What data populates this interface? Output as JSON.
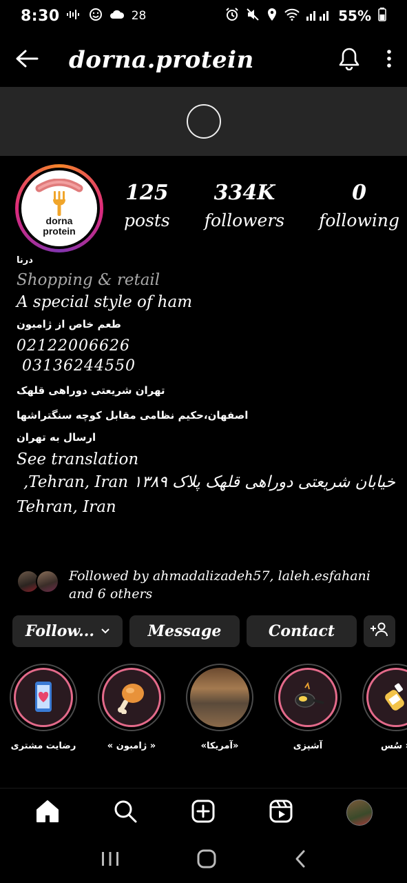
{
  "status_bar": {
    "time": "8:30",
    "left_text": "28",
    "battery": "55%"
  },
  "header": {
    "username": "dorna.protein"
  },
  "profile": {
    "logo_line1": "dorna",
    "logo_line2": "protein",
    "stats": {
      "posts_count": "125",
      "posts_label": "posts",
      "followers_count": "334K",
      "followers_label": "followers",
      "following_count": "0",
      "following_label": "following"
    }
  },
  "bio": {
    "name": "درنا",
    "category": "Shopping & retail",
    "line1": "A special style of ham",
    "line2": "طعم خاص از ژامبون",
    "phone1": "02122006626",
    "phone2": " 03136244550",
    "address1": "تهران شریعتی دوراهی قلهک",
    "address2": "اصفهان،حکیم نظامی مقابل کوچه سنگتراشها",
    "line3": "ارسال به تهران",
    "see_translation": "See translation",
    "location_line1": "خیابان شریعتی دوراهی قلهک پلاک ۱۳۸۹ Tehran, Iran,",
    "location_line2": "Tehran, Iran"
  },
  "followed_by": {
    "text_line1": "Followed by ahmadalizadeh57, laleh.esfahani",
    "text_line2": "and 6 others"
  },
  "buttons": {
    "follow": "Follow...",
    "message": "Message",
    "contact": "Contact"
  },
  "highlights": [
    {
      "label": "رضایت مشتری",
      "icon": "phone-heart-icon"
    },
    {
      "label": "« ژامبون »",
      "icon": "drumstick-icon"
    },
    {
      "label": "«آمریکا»",
      "icon": "food-photo"
    },
    {
      "label": "آشپزی",
      "icon": "pan-icon"
    },
    {
      "label": "« سُس",
      "icon": "sauce-bottle-icon"
    }
  ],
  "colors": {
    "background": "#000000",
    "button_bg": "#262626",
    "highlight_ring": "#e36a8a",
    "category_text": "#a8a8a8"
  }
}
